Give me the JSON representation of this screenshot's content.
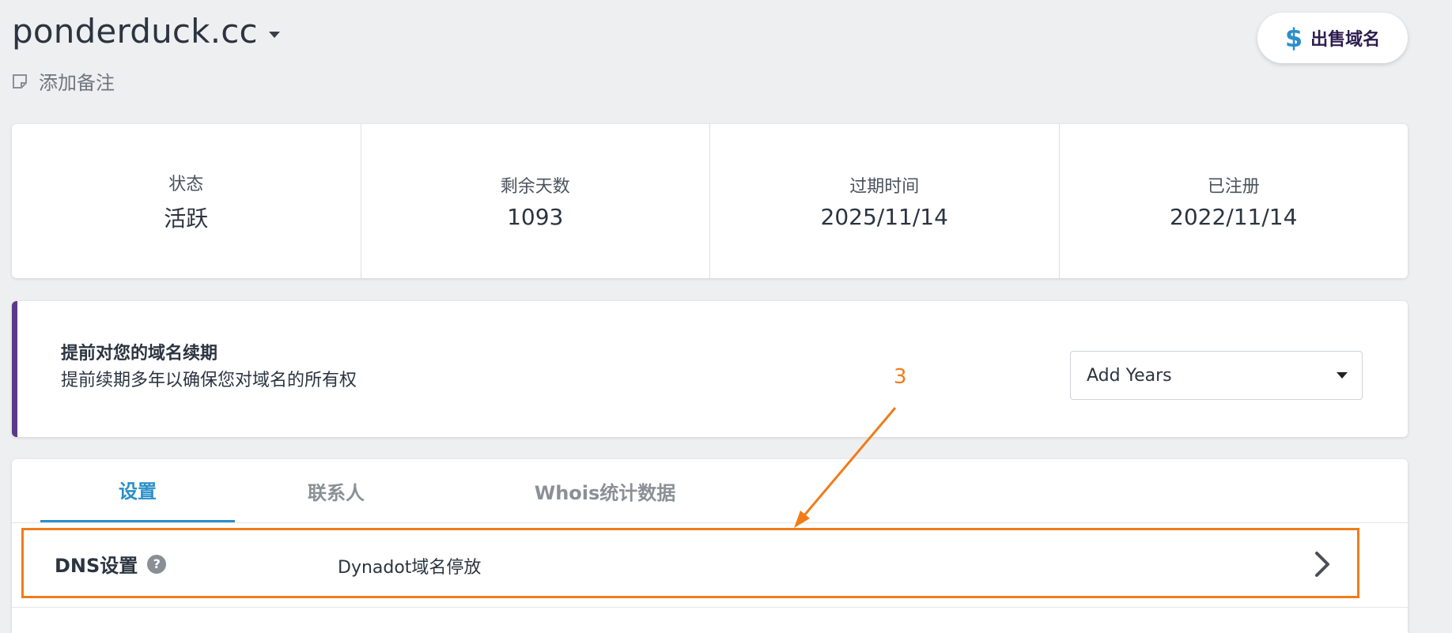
{
  "header": {
    "domain_name": "ponderduck.cc",
    "add_note_label": "添加备注",
    "sell_button_label": "出售域名",
    "sell_icon_glyph": "$"
  },
  "stats": [
    {
      "label": "状态",
      "value": "活跃"
    },
    {
      "label": "剩余天数",
      "value": "1093"
    },
    {
      "label": "过期时间",
      "value": "2025/11/14"
    },
    {
      "label": "已注册",
      "value": "2022/11/14"
    }
  ],
  "renewal": {
    "title": "提前对您的域名续期",
    "description": "提前续期多年以确保您对域名的所有权",
    "select_value": "Add Years"
  },
  "tabs": [
    {
      "label": "设置",
      "active": true
    },
    {
      "label": "联系人",
      "active": false
    },
    {
      "label": "Whois统计数据",
      "active": false
    }
  ],
  "dns_row": {
    "label": "DNS设置",
    "help_glyph": "?",
    "value": "Dynadot域名停放"
  },
  "annotation": {
    "number": "3"
  },
  "colors": {
    "accent_blue": "#2a8fc9",
    "accent_purple": "#5a3a87",
    "annotation_orange": "#f07c1a",
    "background": "#eeeff1"
  }
}
